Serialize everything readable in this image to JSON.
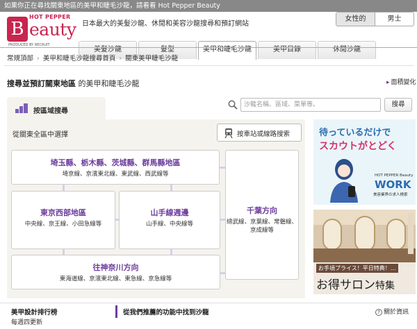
{
  "notice": "如果你正在尋找關東地區的美甲和睫毛沙龍，請看看 Hot Pepper Beauty",
  "logo": {
    "hot_pepper": "HOT PEPPER",
    "mark": "B",
    "word": "eauty",
    "produced_by": "PRODUCED BY RECRUIT"
  },
  "header": {
    "tagline": "日本最大的美髮沙龍、休閒和美容沙龍搜尋和預訂網站",
    "gender": {
      "female": "女性的",
      "male": "男士"
    }
  },
  "nav": {
    "tabs": [
      {
        "label": "美髮沙龍",
        "active": false
      },
      {
        "label": "髮型",
        "active": false
      },
      {
        "label": "美甲和睫毛沙龍",
        "active": true
      },
      {
        "label": "美甲目錄",
        "active": false
      },
      {
        "label": "休閒沙龍",
        "active": false
      }
    ]
  },
  "breadcrumb": [
    "常規頂部",
    "美甲和睫毛沙龍搜尋首頁",
    "關東美甲睫毛沙龍"
  ],
  "page": {
    "title_bold": "搜尋並預訂關東地區",
    "title_rest": "的美甲和睫毛沙龍",
    "face_change": "面積變化"
  },
  "area_tab": "按區域搜尋",
  "search": {
    "placeholder": "沙龍名稱、區域、菜單等。",
    "button": "搜尋"
  },
  "panel": {
    "lead": "從關東全區中選擇",
    "station_button": "按車站或線路搜索"
  },
  "regions": [
    {
      "name": "埼玉縣、栃木縣、茨城縣、群馬縣地區",
      "lines": "埼京線、京濱東北線、東武線、西武線等"
    },
    {
      "name": "東京西部地區",
      "lines": "中央線、京王線、小田急線等"
    },
    {
      "name": "山手線週邊",
      "lines": "山手線、中央線等"
    },
    {
      "name": "千葉方向",
      "lines": "總武線、京葉線、常磐線、京成線等"
    },
    {
      "name": "往神奈川方向",
      "lines": "東海道線、京濱東北線、東急線、京急線等"
    }
  ],
  "ads": {
    "work": {
      "line1": "待っているだけで",
      "line2": "スカウトがとどく",
      "brand": "HOT PEPPER Beauty",
      "work": "WORK",
      "caption": "美容業界の求人検索"
    },
    "salon": {
      "small": "お手頃プライス！平日特典！…",
      "big": "お得サロン",
      "tokushu": "特集"
    }
  },
  "footer": {
    "ranking": "美甲設計排行榜",
    "ranking_sub": "每週四更新",
    "recommend": "從我們推薦的功能中找到沙龍",
    "about": "關於資訊"
  },
  "colors": {
    "brand": "#c8254f",
    "accent_purple": "#6c3d9c",
    "panel_bg": "#f5f3ee"
  }
}
